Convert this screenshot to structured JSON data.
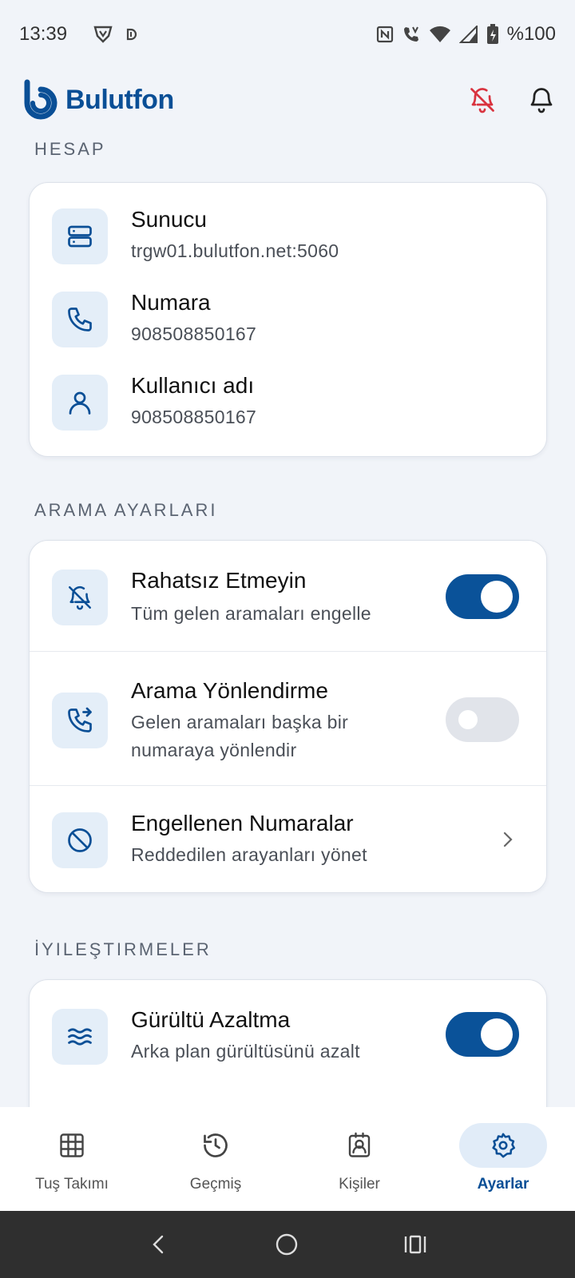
{
  "status_bar": {
    "time": "13:39",
    "battery": "%100"
  },
  "header": {
    "brand": "Bulutfon"
  },
  "sections": {
    "account": {
      "title": "HESAP",
      "rows": [
        {
          "title": "Sunucu",
          "subtitle": "trgw01.bulutfon.net:5060",
          "icon": "server-icon"
        },
        {
          "title": "Numara",
          "subtitle": "908508850167",
          "icon": "phone-icon"
        },
        {
          "title": "Kullanıcı adı",
          "subtitle": "908508850167",
          "icon": "user-icon"
        }
      ]
    },
    "call_settings": {
      "title": "ARAMA AYARLARI",
      "rows": [
        {
          "title": "Rahatsız Etmeyin",
          "subtitle": "Tüm gelen aramaları engelle",
          "icon": "bell-off-icon",
          "toggle": true
        },
        {
          "title": "Arama Yönlendirme",
          "subtitle_line1": "Gelen aramaları başka bir",
          "subtitle_line2": "numaraya yönlendir",
          "icon": "phone-forward-icon",
          "toggle": false
        },
        {
          "title": "Engellenen Numaralar",
          "subtitle": "Reddedilen arayanları yönet",
          "icon": "block-icon"
        }
      ]
    },
    "improvements": {
      "title": "İYILEŞTIRMELER",
      "rows": [
        {
          "title": "Gürültü Azaltma",
          "subtitle": "Arka plan gürültüsünü azalt",
          "icon": "waves-icon",
          "toggle": true
        }
      ]
    }
  },
  "bottom_nav": [
    {
      "label": "Tuş Takımı",
      "icon": "keypad-icon",
      "active": false
    },
    {
      "label": "Geçmiş",
      "icon": "history-icon",
      "active": false
    },
    {
      "label": "Kişiler",
      "icon": "contacts-icon",
      "active": false
    },
    {
      "label": "Ayarlar",
      "icon": "gear-icon",
      "active": true
    }
  ],
  "colors": {
    "brand": "#0a4f96",
    "toggle_on": "#0a5299",
    "alert": "#d9333f"
  }
}
